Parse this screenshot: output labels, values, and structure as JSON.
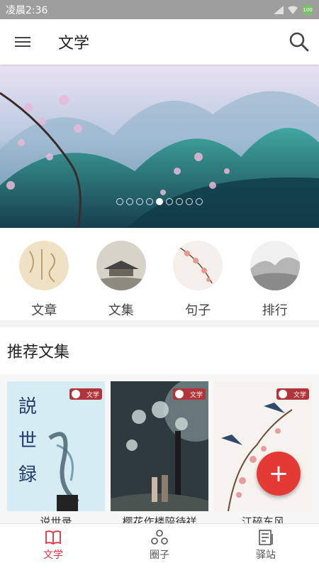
{
  "status_bar": {
    "time": "凌晨2:36",
    "battery": "100"
  },
  "app_bar": {
    "title": "文学",
    "menu_icon": "hamburger-menu-icon",
    "search_icon": "search-icon"
  },
  "banner": {
    "slide_count": 9,
    "active_index": 4
  },
  "categories": [
    {
      "label": "文章"
    },
    {
      "label": "文集"
    },
    {
      "label": "句子"
    },
    {
      "label": "排行"
    }
  ],
  "section": {
    "title": "推荐文集"
  },
  "books": [
    {
      "cover_text": "説世録",
      "title": "说世录",
      "badge": "文学"
    },
    {
      "cover_text": "",
      "title": "樱花作楼陪待祥",
      "badge": "文学"
    },
    {
      "cover_text": "",
      "title": "江碎东风",
      "badge": "文学"
    }
  ],
  "fab": {
    "label": "+"
  },
  "bottom_nav": [
    {
      "label": "文学",
      "icon": "book-icon",
      "active": true
    },
    {
      "label": "圈子",
      "icon": "circles-icon",
      "active": false
    },
    {
      "label": "驿站",
      "icon": "newspaper-icon",
      "active": false
    }
  ],
  "colors": {
    "accent": "#d9333f",
    "fab": "#e53935"
  }
}
